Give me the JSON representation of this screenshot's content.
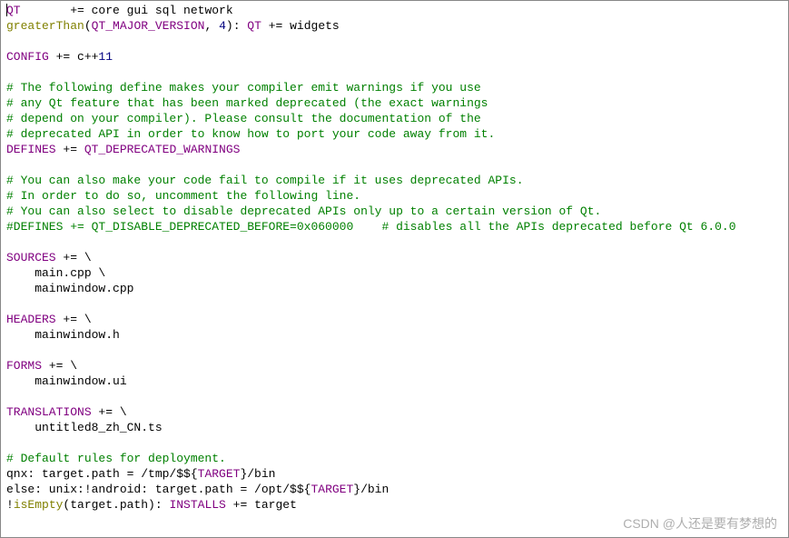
{
  "code": {
    "lines": [
      {
        "segments": [
          {
            "t": "QT",
            "c": "kw"
          },
          {
            "t": "       += core gui sql network",
            "c": "op"
          }
        ]
      },
      {
        "segments": [
          {
            "t": "greaterThan",
            "c": "fn"
          },
          {
            "t": "(",
            "c": "op"
          },
          {
            "t": "QT_MAJOR_VERSION",
            "c": "kw"
          },
          {
            "t": ", ",
            "c": "op"
          },
          {
            "t": "4",
            "c": "num"
          },
          {
            "t": "): ",
            "c": "op"
          },
          {
            "t": "QT",
            "c": "kw"
          },
          {
            "t": " += widgets",
            "c": "op"
          }
        ]
      },
      {
        "segments": []
      },
      {
        "segments": [
          {
            "t": "CONFIG",
            "c": "kw"
          },
          {
            "t": " += c++",
            "c": "op"
          },
          {
            "t": "11",
            "c": "num"
          }
        ]
      },
      {
        "segments": []
      },
      {
        "segments": [
          {
            "t": "# The following define makes your compiler emit warnings if you use",
            "c": "cm"
          }
        ]
      },
      {
        "segments": [
          {
            "t": "# any Qt feature that has been marked deprecated (the exact warnings",
            "c": "cm"
          }
        ]
      },
      {
        "segments": [
          {
            "t": "# depend on your compiler). Please consult the documentation of the",
            "c": "cm"
          }
        ]
      },
      {
        "segments": [
          {
            "t": "# deprecated API in order to know how to port your code away from it.",
            "c": "cm"
          }
        ]
      },
      {
        "segments": [
          {
            "t": "DEFINES",
            "c": "kw"
          },
          {
            "t": " += ",
            "c": "op"
          },
          {
            "t": "QT_DEPRECATED_WARNINGS",
            "c": "kw"
          }
        ]
      },
      {
        "segments": []
      },
      {
        "segments": [
          {
            "t": "# You can also make your code fail to compile if it uses deprecated APIs.",
            "c": "cm"
          }
        ]
      },
      {
        "segments": [
          {
            "t": "# In order to do so, uncomment the following line.",
            "c": "cm"
          }
        ]
      },
      {
        "segments": [
          {
            "t": "# You can also select to disable deprecated APIs only up to a certain version of Qt.",
            "c": "cm"
          }
        ]
      },
      {
        "segments": [
          {
            "t": "#DEFINES += QT_DISABLE_DEPRECATED_BEFORE=0x060000    # disables all the APIs deprecated before Qt 6.0.0",
            "c": "cm"
          }
        ]
      },
      {
        "segments": []
      },
      {
        "segments": [
          {
            "t": "SOURCES",
            "c": "kw"
          },
          {
            "t": " += \\",
            "c": "op"
          }
        ]
      },
      {
        "segments": [
          {
            "t": "    main.cpp \\",
            "c": "op"
          }
        ]
      },
      {
        "segments": [
          {
            "t": "    mainwindow.cpp",
            "c": "op"
          }
        ]
      },
      {
        "segments": []
      },
      {
        "segments": [
          {
            "t": "HEADERS",
            "c": "kw"
          },
          {
            "t": " += \\",
            "c": "op"
          }
        ]
      },
      {
        "segments": [
          {
            "t": "    mainwindow.h",
            "c": "op"
          }
        ]
      },
      {
        "segments": []
      },
      {
        "segments": [
          {
            "t": "FORMS",
            "c": "kw"
          },
          {
            "t": " += \\",
            "c": "op"
          }
        ]
      },
      {
        "segments": [
          {
            "t": "    mainwindow.ui",
            "c": "op"
          }
        ]
      },
      {
        "segments": []
      },
      {
        "segments": [
          {
            "t": "TRANSLATIONS",
            "c": "kw"
          },
          {
            "t": " += \\",
            "c": "op"
          }
        ]
      },
      {
        "segments": [
          {
            "t": "    untitled8_zh_CN.ts",
            "c": "op"
          }
        ]
      },
      {
        "segments": []
      },
      {
        "segments": [
          {
            "t": "# Default rules for deployment.",
            "c": "cm"
          }
        ]
      },
      {
        "segments": [
          {
            "t": "qnx: target.path = /tmp/$${",
            "c": "op"
          },
          {
            "t": "TARGET",
            "c": "kw"
          },
          {
            "t": "}/bin",
            "c": "op"
          }
        ]
      },
      {
        "segments": [
          {
            "t": "else: unix:!android: target.path = /opt/$${",
            "c": "op"
          },
          {
            "t": "TARGET",
            "c": "kw"
          },
          {
            "t": "}/bin",
            "c": "op"
          }
        ]
      },
      {
        "segments": [
          {
            "t": "!",
            "c": "op"
          },
          {
            "t": "isEmpty",
            "c": "fn"
          },
          {
            "t": "(target.path): ",
            "c": "op"
          },
          {
            "t": "INSTALLS",
            "c": "kw"
          },
          {
            "t": " += target",
            "c": "op"
          }
        ]
      }
    ]
  },
  "watermark": "CSDN @人还是要有梦想的"
}
